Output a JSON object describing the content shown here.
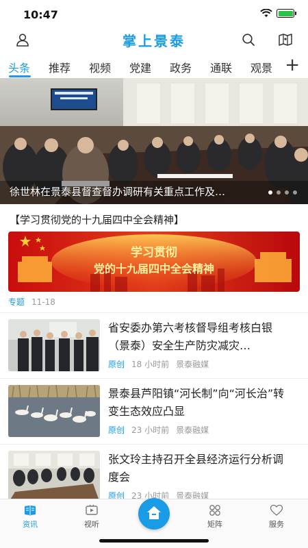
{
  "status_bar": {
    "time": "10:47"
  },
  "header": {
    "title": "掌上景泰",
    "profile_icon": "user-icon",
    "search_icon": "search-icon",
    "map_icon": "map-icon"
  },
  "tabs": [
    "头条",
    "推荐",
    "视频",
    "党建",
    "政务",
    "通联",
    "观景"
  ],
  "active_tab": "头条",
  "banner": {
    "caption": "徐世林在景泰县督查督办调研有关重点工作及…",
    "slides": 4,
    "active_slide": 1
  },
  "topic": {
    "title": "【学习贯彻党的十九届四中全会精神】",
    "image_text_line1": "学习贯彻",
    "image_text_line2": "党的十九届四中全会精神",
    "tag": "专题",
    "date": "11-18"
  },
  "news": [
    {
      "headline": "省安委办第六考核督导组考核白银（景泰）安全生产防灾减灾…",
      "type": "原创",
      "ago": "18 小时前",
      "source": "景泰融媒"
    },
    {
      "headline": "景泰县芦阳镇“河长制”向“河长治”转变生态效应凸显",
      "type": "原创",
      "ago": "23 小时前",
      "source": "景泰融媒"
    },
    {
      "headline": "张文玲主持召开全县经济运行分析调度会",
      "type": "原创",
      "ago": "23 小时前",
      "source": "景泰融媒"
    }
  ],
  "bottom_nav": [
    {
      "label": "资讯",
      "icon": "news-icon"
    },
    {
      "label": "视听",
      "icon": "video-icon"
    },
    {
      "label": "",
      "icon": "home-icon"
    },
    {
      "label": "矩阵",
      "icon": "matrix-icon"
    },
    {
      "label": "服务",
      "icon": "heart-icon"
    }
  ],
  "colors": {
    "brand": "#1a9be6",
    "topic_red": "#d11a1a"
  }
}
